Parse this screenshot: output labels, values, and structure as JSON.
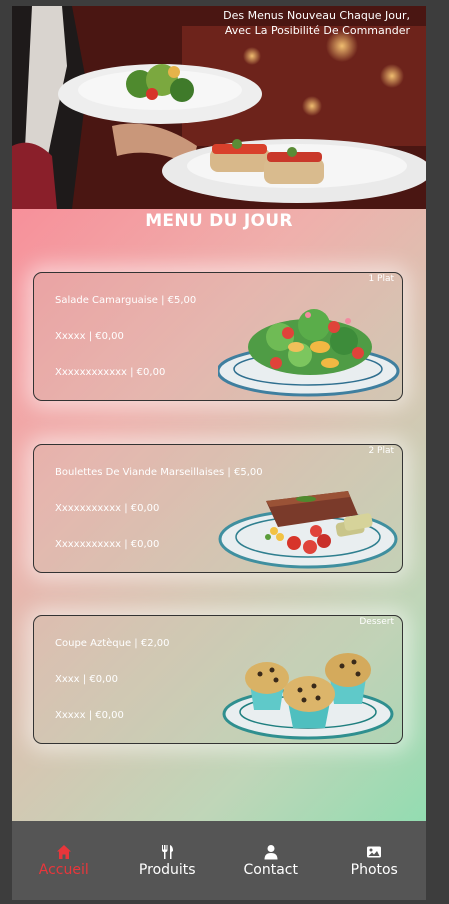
{
  "hero": {
    "tagline_line1": "Des Menus Nouveau Chaque Jour,",
    "tagline_line2": "Avec La Posibilité De Commander"
  },
  "menu": {
    "title": "MENU DU JOUR",
    "cards": [
      {
        "badge": "1 Plat",
        "items": [
          "Salade Camarguaise | €5,00",
          "Xxxxx | €0,00",
          "Xxxxxxxxxxxx | €0,00"
        ],
        "image": "salad-plate"
      },
      {
        "badge": "2 Plat",
        "items": [
          "Boulettes De Viande Marseillaises | €5,00",
          "Xxxxxxxxxxx | €0,00",
          "Xxxxxxxxxxx | €0,00"
        ],
        "image": "steak-plate"
      },
      {
        "badge": "Dessert",
        "items": [
          "Coupe Aztèque | €2,00",
          "Xxxx | €0,00",
          "Xxxxx | €0,00"
        ],
        "image": "muffins-plate"
      }
    ]
  },
  "nav": {
    "items": [
      {
        "label": "Accueil",
        "icon": "home-icon",
        "active": true
      },
      {
        "label": "Produits",
        "icon": "utensils-icon",
        "active": false
      },
      {
        "label": "Contact",
        "icon": "user-icon",
        "active": false
      },
      {
        "label": "Photos",
        "icon": "image-icon",
        "active": false
      }
    ],
    "active_color": "#e8363b"
  }
}
